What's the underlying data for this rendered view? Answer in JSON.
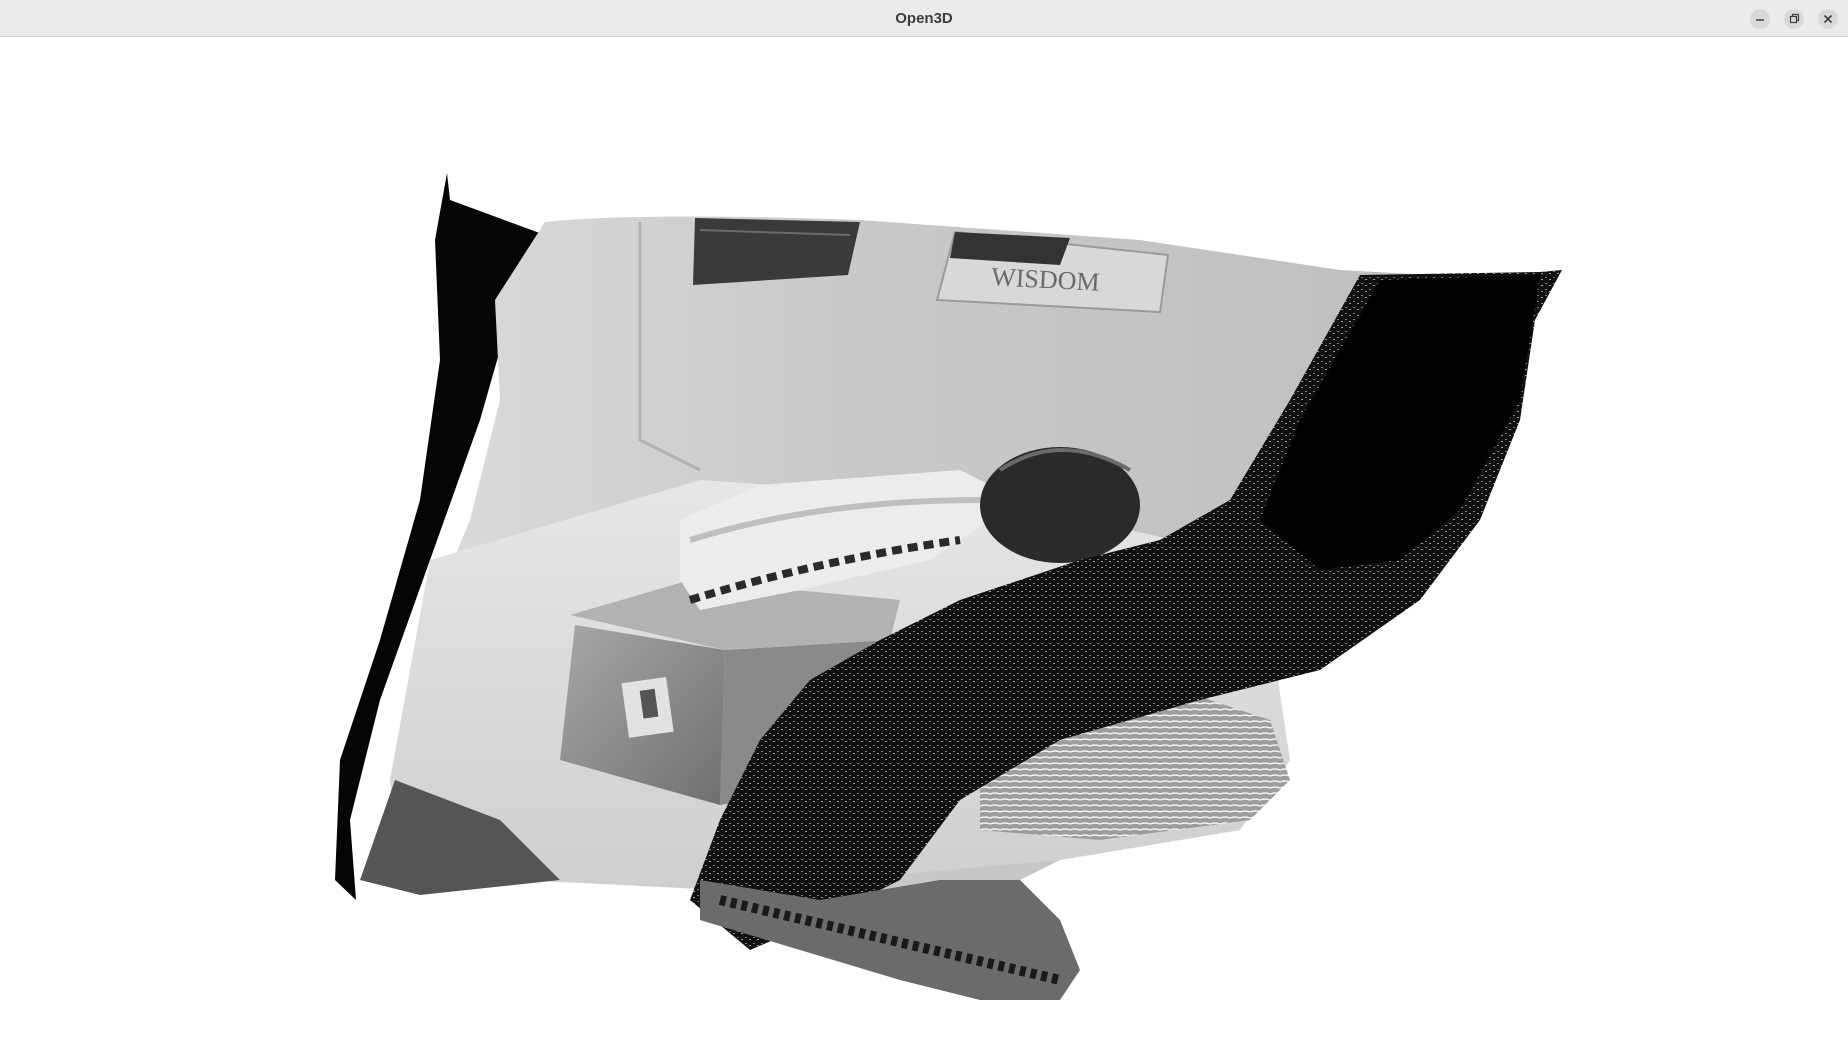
{
  "window": {
    "title": "Open3D",
    "controls": {
      "minimize": "minimize-icon",
      "maximize": "restore-icon",
      "close": "close-icon"
    }
  },
  "viewport": {
    "content": "point-cloud-render",
    "background_color": "#ffffff",
    "wall_text": "WISDOM"
  },
  "colors": {
    "titlebar": "#ebebeb",
    "title_text": "#3d3d3d",
    "button_bg": "#d9d9d9"
  }
}
